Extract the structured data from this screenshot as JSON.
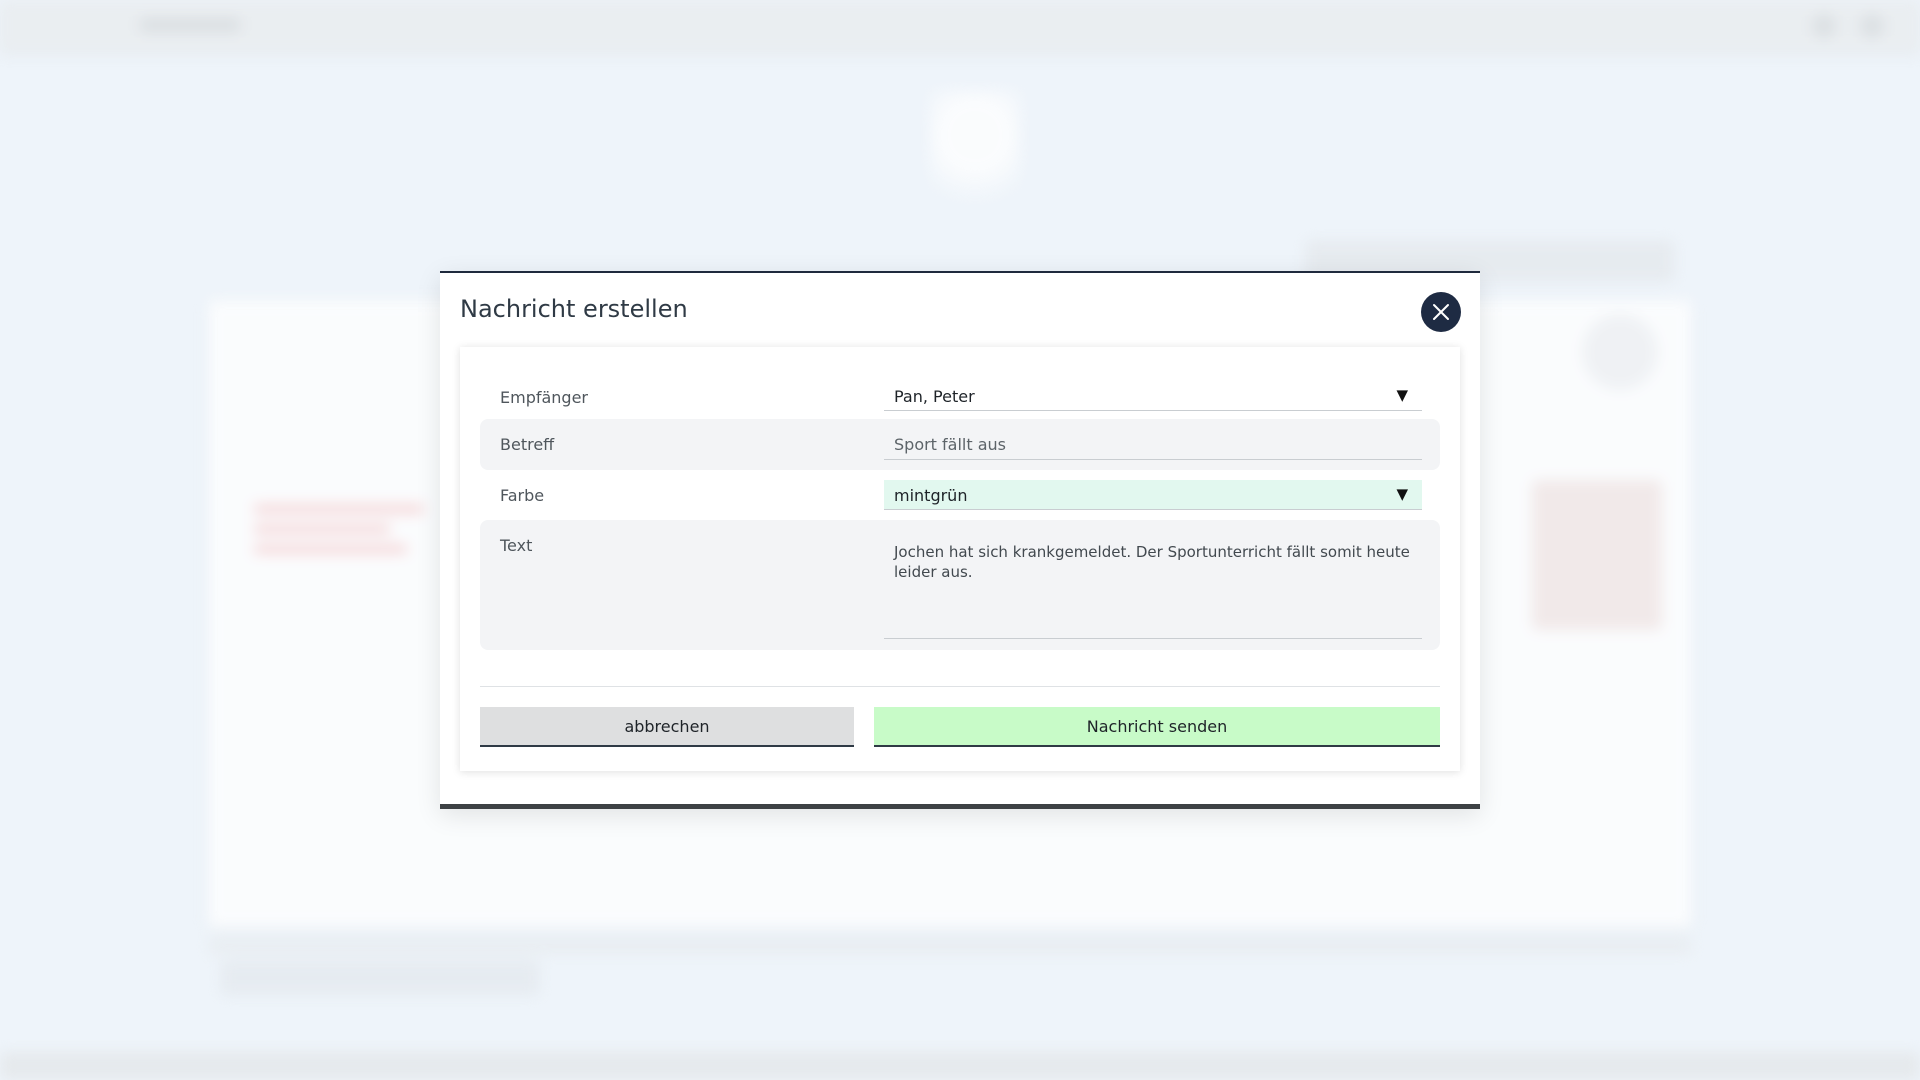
{
  "modal": {
    "title": "Nachricht erstellen",
    "close_icon": "close-icon",
    "fields": {
      "recipient": {
        "label": "Empfänger",
        "value": "Pan, Peter"
      },
      "subject": {
        "label": "Betreff",
        "value": "Sport fällt aus"
      },
      "color": {
        "label": "Farbe",
        "value": "mintgrün",
        "highlight": "#e2f8ef"
      },
      "text": {
        "label": "Text",
        "value": "Jochen hat sich krankgemeldet. Der Sportunterricht fällt somit heute leider aus."
      }
    },
    "buttons": {
      "cancel": "abbrechen",
      "send": "Nachricht senden"
    }
  },
  "colors": {
    "close_button": "#1e2b43",
    "send_button": "#c8fbc8",
    "cancel_button": "#dedfe0"
  }
}
